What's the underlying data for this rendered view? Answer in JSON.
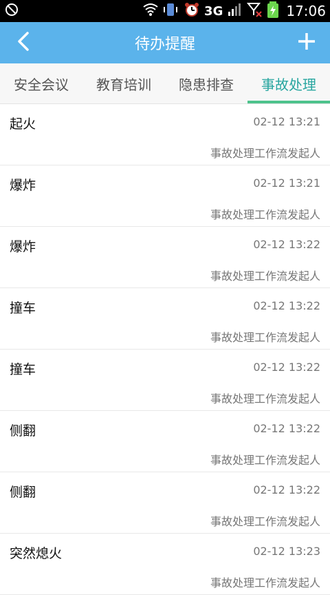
{
  "status": {
    "network": "3G",
    "time": "17:06"
  },
  "header": {
    "title": "待办提醒"
  },
  "tabs": [
    {
      "label": "安全会议"
    },
    {
      "label": "教育培训"
    },
    {
      "label": "隐患排查"
    },
    {
      "label": "事故处理"
    }
  ],
  "items": [
    {
      "name": "起火",
      "time": "02-12 13:21",
      "initiator": "事故处理工作流发起人"
    },
    {
      "name": "爆炸",
      "time": "02-12 13:21",
      "initiator": "事故处理工作流发起人"
    },
    {
      "name": "爆炸",
      "time": "02-12 13:22",
      "initiator": "事故处理工作流发起人"
    },
    {
      "name": "撞车",
      "time": "02-12 13:22",
      "initiator": "事故处理工作流发起人"
    },
    {
      "name": "撞车",
      "time": "02-12 13:22",
      "initiator": "事故处理工作流发起人"
    },
    {
      "name": "侧翻",
      "time": "02-12 13:22",
      "initiator": "事故处理工作流发起人"
    },
    {
      "name": "侧翻",
      "time": "02-12 13:22",
      "initiator": "事故处理工作流发起人"
    },
    {
      "name": "突然熄火",
      "time": "02-12 13:23",
      "initiator": "事故处理工作流发起人"
    }
  ],
  "colors": {
    "appbar": "#5bb3eb",
    "tab_active_text": "#28a6a0",
    "tab_indicator": "#4dc38c"
  }
}
